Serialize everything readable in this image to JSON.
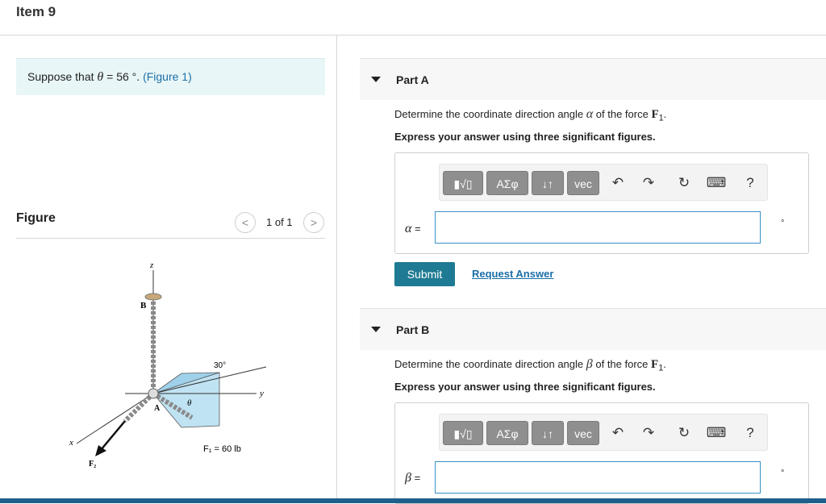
{
  "header": {
    "title": "Item 9"
  },
  "prompt": {
    "text": "Suppose that",
    "symbol": "θ",
    "value": " = 56 °.",
    "link": "(Figure 1)"
  },
  "figure": {
    "heading": "Figure",
    "pager": {
      "text": "1 of 1",
      "prev": "<",
      "next": ">"
    },
    "labels": {
      "z": "z",
      "y": "y",
      "x": "x",
      "B": "B",
      "A": "A",
      "angle30": "30°",
      "theta": "θ",
      "F1": "F₁ = 60 lb",
      "F2": "F₂"
    }
  },
  "partA": {
    "label": "Part A",
    "question_pre": "Determine the coordinate direction angle",
    "symbol": "α",
    "question_mid": "of the force",
    "force": "F",
    "force_sub": "1",
    "question_end": ".",
    "instruction": "Express your answer using three significant figures.",
    "var": "α",
    "eq": "=",
    "unit": "°",
    "input_value": ""
  },
  "partB": {
    "label": "Part B",
    "question_pre": "Determine the coordinate direction angle",
    "symbol": "β",
    "question_mid": "of the force",
    "force": "F",
    "force_sub": "1",
    "question_end": ".",
    "instruction": "Express your answer using three significant figures.",
    "var": "β",
    "eq": "=",
    "unit": "°",
    "input_value": ""
  },
  "toolbar": {
    "templates": "▮√▯",
    "greek": "ΑΣφ",
    "arrows": "↓↑",
    "vec": "vec",
    "undo": "↶",
    "redo": "↷",
    "reset": "↻",
    "keyboard": "⌨",
    "help": "?"
  },
  "actions": {
    "submit": "Submit",
    "request": "Request Answer"
  }
}
